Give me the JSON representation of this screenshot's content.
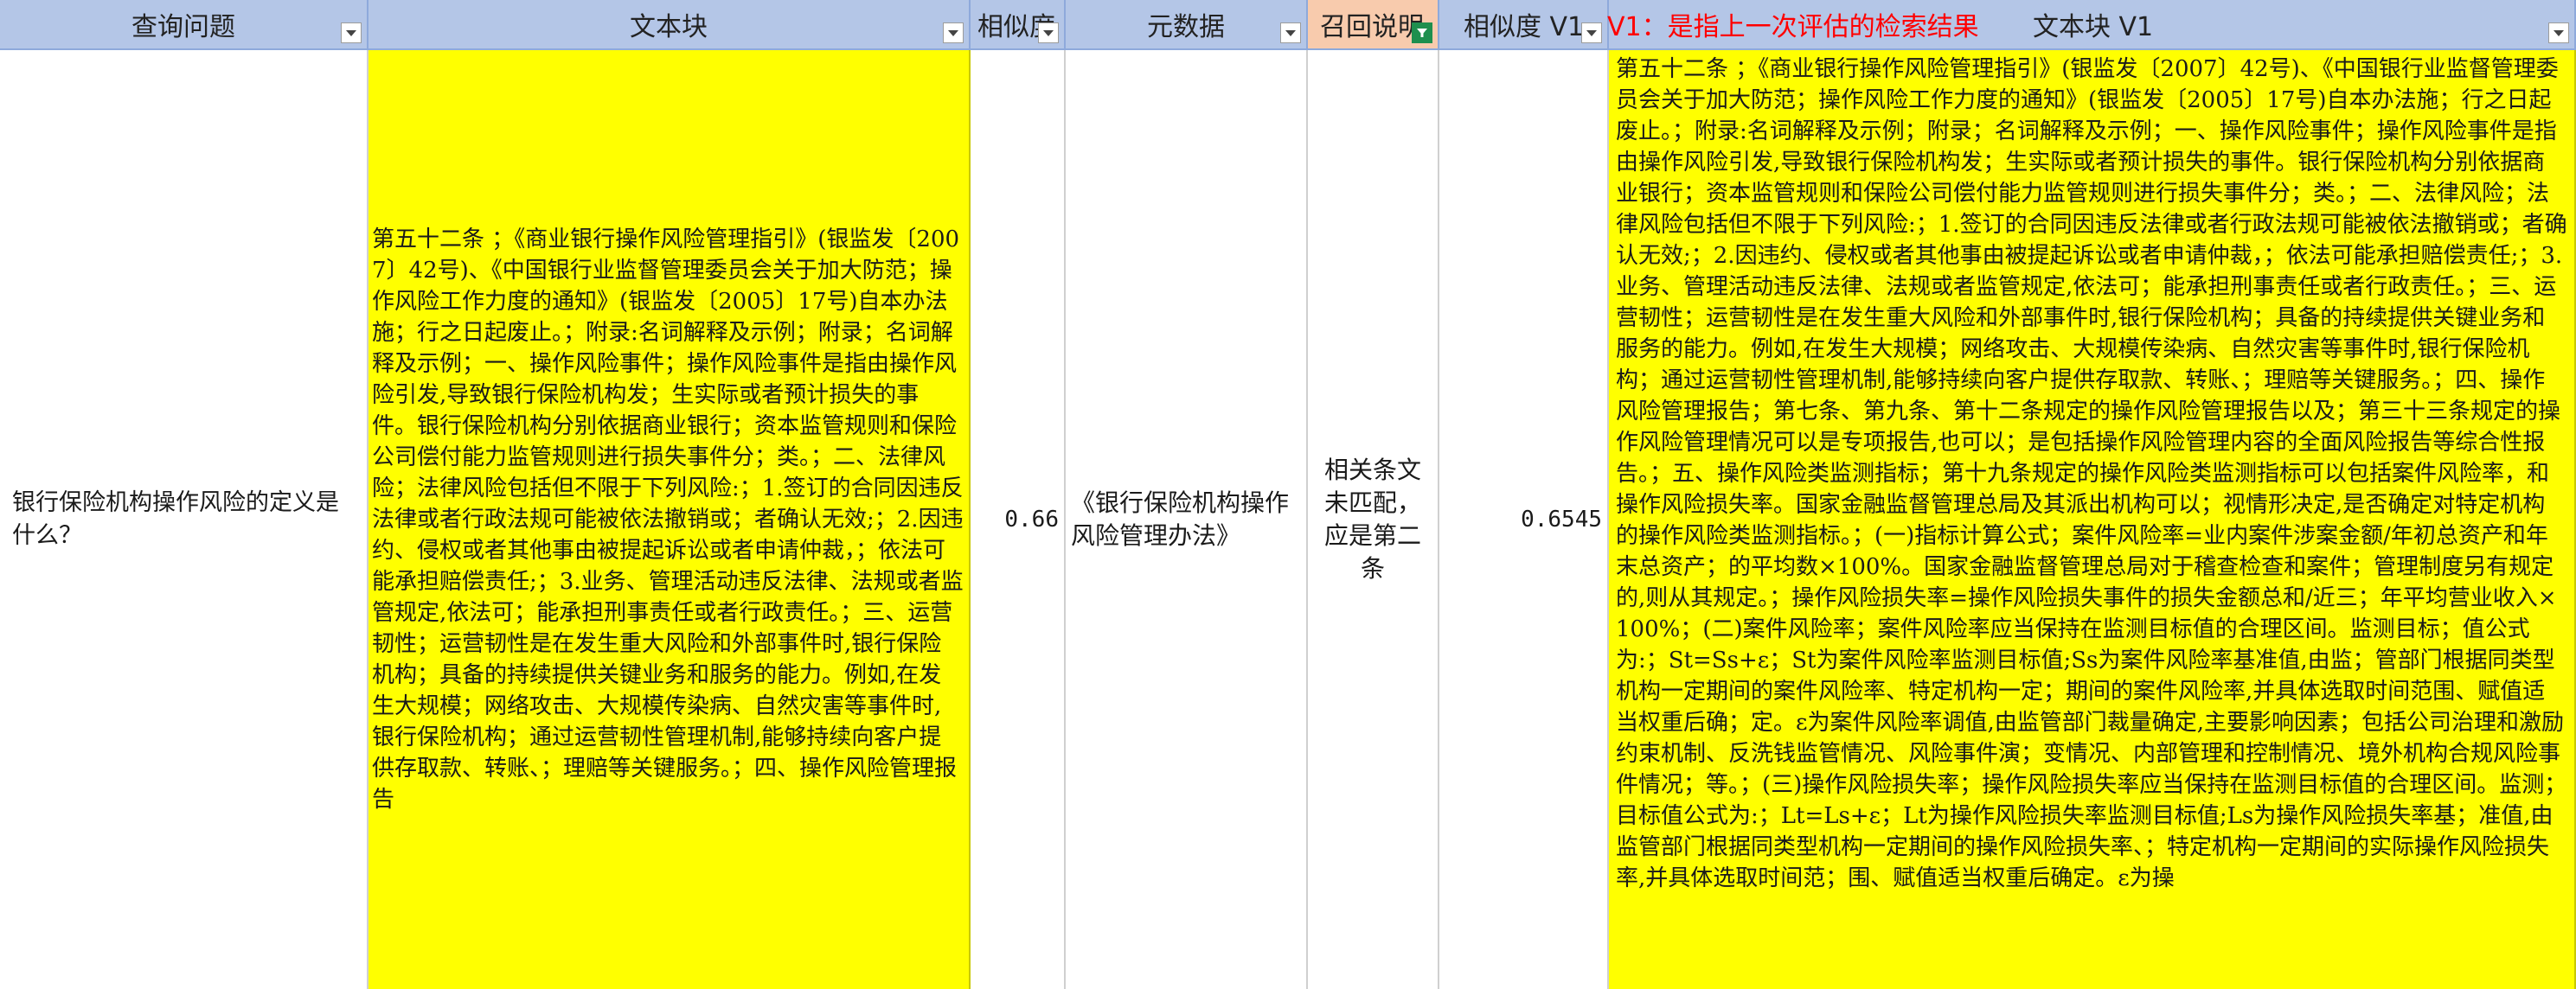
{
  "headers": {
    "query": "查询问题",
    "text_block": "文本块",
    "similarity": "相似度",
    "metadata": "元数据",
    "recall_note": "召回说明",
    "similarity_v1": "相似度 V1",
    "text_block_v1": "文本块 V1"
  },
  "annotation": "V1：是指上一次评估的检索结果",
  "row": {
    "query": "银行保险机构操作风险的定义是什么？",
    "text_block": "第五十二条 ；《商业银行操作风险管理指引》(银监发〔2007〕42号)、《中国银行业监督管理委员会关于加大防范；操作风险工作力度的通知》(银监发〔2005〕17号)自本办法施；行之日起废止。；附录:名词解释及示例；附录；名词解释及示例；一、操作风险事件；操作风险事件是指由操作风险引发,导致银行保险机构发；生实际或者预计损失的事件。银行保险机构分别依据商业银行；资本监管规则和保险公司偿付能力监管规则进行损失事件分；类。；二、法律风险；法律风险包括但不限于下列风险:；1.签订的合同因违反法律或者行政法规可能被依法撤销或；者确认无效;；2.因违约、侵权或者其他事由被提起诉讼或者申请仲裁，；依法可能承担赔偿责任;；3.业务、管理活动违反法律、法规或者监管规定,依法可；能承担刑事责任或者行政责任。；三、运营韧性；运营韧性是在发生重大风险和外部事件时,银行保险机构；具备的持续提供关键业务和服务的能力。例如,在发生大规模；网络攻击、大规模传染病、自然灾害等事件时,银行保险机构；通过运营韧性管理机制,能够持续向客户提供存取款、转账、；理赔等关键服务。；四、操作风险管理报告",
    "similarity": "0.66",
    "metadata": "《银行保险机构操作风险管理办法》",
    "recall_note": "相关条文未匹配，应是第二条",
    "similarity_v1": "0.6545",
    "text_block_v1": "第五十二条 ；《商业银行操作风险管理指引》(银监发〔2007〕42号)、《中国银行业监督管理委员会关于加大防范；操作风险工作力度的通知》(银监发〔2005〕17号)自本办法施；行之日起废止。；附录:名词解释及示例；附录；名词解释及示例；一、操作风险事件；操作风险事件是指由操作风险引发,导致银行保险机构发；生实际或者预计损失的事件。银行保险机构分别依据商业银行；资本监管规则和保险公司偿付能力监管规则进行损失事件分；类。；二、法律风险；法律风险包括但不限于下列风险:；1.签订的合同因违反法律或者行政法规可能被依法撤销或；者确认无效;；2.因违约、侵权或者其他事由被提起诉讼或者申请仲裁，；依法可能承担赔偿责任;；3.业务、管理活动违反法律、法规或者监管规定,依法可；能承担刑事责任或者行政责任。；三、运营韧性；运营韧性是在发生重大风险和外部事件时,银行保险机构；具备的持续提供关键业务和服务的能力。例如,在发生大规模；网络攻击、大规模传染病、自然灾害等事件时,银行保险机构；通过运营韧性管理机制,能够持续向客户提供存取款、转账、；理赔等关键服务。；四、操作风险管理报告；第七条、第九条、第十二条规定的操作风险管理报告以及；第三十三条规定的操作风险管理情况可以是专项报告,也可以；是包括操作风险管理内容的全面风险报告等综合性报告。；五、操作风险类监测指标；第十九条规定的操作风险类监测指标可以包括案件风险率，和操作风险损失率。国家金融监督管理总局及其派出机构可以；视情形决定,是否确定对特定机构的操作风险类监测指标。；(一)指标计算公式；案件风险率=业内案件涉案金额/年初总资产和年末总资产；的平均数×100%。国家金融监督管理总局对于稽查检查和案件；管理制度另有规定的,则从其规定。；操作风险损失率=操作风险损失事件的损失金额总和/近三；年平均营业收入×100%；(二)案件风险率；案件风险率应当保持在监测目标值的合理区间。监测目标；值公式为:；St=Ss+ε；St为案件风险率监测目标值;Ss为案件风险率基准值,由监；管部门根据同类型机构一定期间的案件风险率、特定机构一定；期间的案件风险率,并具体选取时间范围、赋值适当权重后确；定。ε为案件风险率调值,由监管部门裁量确定,主要影响因素；包括公司治理和激励约束机制、反洗钱监管情况、风险事件演；变情况、内部管理和控制情况、境外机构合规风险事件情况；等。；(三)操作风险损失率；操作风险损失率应当保持在监测目标值的合理区间。监测；目标值公式为:；Lt=Ls+ε；Lt为操作风险损失率监测目标值;Ls为操作风险损失率基；准值,由监管部门根据同类型机构一定期间的操作风险损失率、；特定机构一定期间的实际操作风险损失率,并具体选取时间范；围、赋值适当权重后确定。ε为操"
  }
}
